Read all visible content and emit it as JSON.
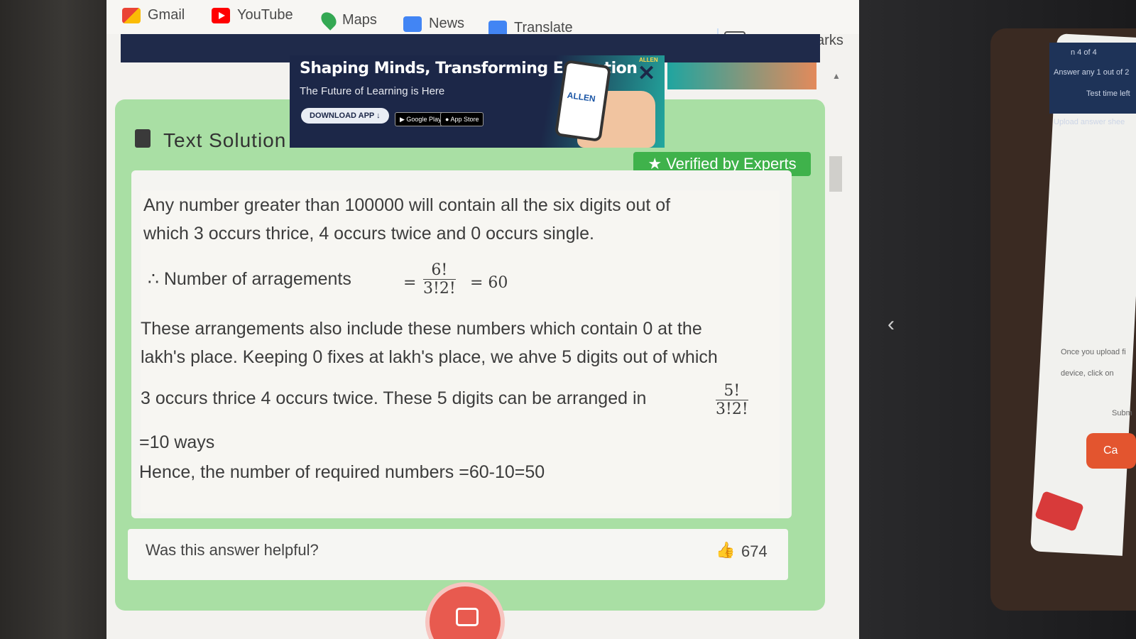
{
  "bookmarks": {
    "items": [
      {
        "label": "Gmail",
        "icon": "gmail-icon"
      },
      {
        "label": "YouTube",
        "icon": "youtube-icon"
      },
      {
        "label": "Maps",
        "icon": "maps-icon"
      },
      {
        "label": "News",
        "icon": "news-icon"
      },
      {
        "label": "Translate",
        "icon": "translate-icon"
      }
    ],
    "all_bookmarks": "All Bookmarks"
  },
  "ad": {
    "headline": "Shaping Minds, Transforming Education",
    "subline": "The Future of Learning is Here",
    "download": "DOWNLOAD APP",
    "google_play": "Google Play",
    "app_store": "App Store",
    "brand": "ALLEN",
    "phone_brand": "ALLEN"
  },
  "solution": {
    "title": "Text Solution",
    "verified": "Verified by Experts",
    "p1_line1": "Any number greater than 100000 will contain all the six digits out of",
    "p1_line2": "which 3 occurs thrice, 4 occurs twice and 0 occurs single.",
    "arr_label": "∴ Number of arragements",
    "eq1": "=",
    "frac1_num": "6!",
    "frac1_den": "3!2!",
    "eq1_result": "= 60",
    "p2_line1": "These arrangements also include these numbers which contain 0 at the",
    "p2_line2": "lakh's place. Keeping 0 fixes at lakh's place, we ahve 5 digits out of which",
    "p2_line3": "3 occurs thrice 4 occurs twice. These 5 digits can be arranged in",
    "frac2_num": "5!",
    "frac2_den": "3!2!",
    "ways": "=10 ways",
    "hence": "Hence, the number of required numbers =60-10=50"
  },
  "feedback": {
    "question": "Was this answer helpful?",
    "likes": "674"
  },
  "tablet": {
    "line1": "n 4 of 4",
    "line2": "Answer any 1 out of 2",
    "line3": "Test time left",
    "line4": "Upload answer shee",
    "line5": "Once you upload fi",
    "line6": "device, click on",
    "line7": "Subm",
    "button": "Ca"
  },
  "colors": {
    "accent_green": "#3fb24b",
    "card_green": "#a9dfa4",
    "ad_navy": "#1c2748",
    "camera_red": "#e85a4f"
  }
}
